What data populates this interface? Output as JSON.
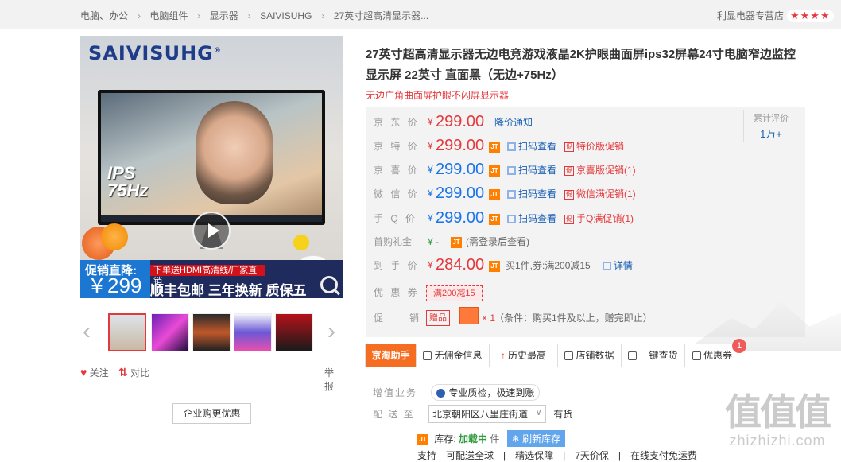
{
  "breadcrumb": [
    "电脑、办公",
    "电脑组件",
    "显示器",
    "SAIVISUHG",
    "27英寸超高清显示器..."
  ],
  "store": {
    "name": "利显电器专营店",
    "stars": "★★★★"
  },
  "gallery": {
    "brand_text": "SAIVISUHG",
    "brand_mark": "®",
    "ips_line1": "IPS",
    "ips_line2": "75Hz",
    "promo_label": "促销直降:",
    "promo_price": "￥299",
    "promo_red": "下单送HDMI高清线/厂家直销",
    "promo_white": "顺丰包邮 三年换新 质保五",
    "prev_arrow": "‹",
    "next_arrow": "›"
  },
  "actions": {
    "follow": "关注",
    "compare": "对比",
    "report": "举报",
    "corp_button": "企业购更优惠"
  },
  "product": {
    "title": "27英寸超高清显示器无边电竞游戏液晶2K护眼曲面屏ips32屏幕24寸电脑窄边监控显示屏 22英寸 直面黑（无边+75Hz）",
    "subtitle": "无边广角曲面屏护眼不闪屏显示器"
  },
  "prices": {
    "jd_label": "京 东 价",
    "jd_price": "299.00",
    "jd_notify": "降价通知",
    "special_label": "京 特 价",
    "special_price": "299.00",
    "special_promo": "特价版促销",
    "xi_label": "京 喜 价",
    "xi_price": "299.00",
    "xi_promo": "京喜版促销(1)",
    "wx_label": "微 信 价",
    "wx_price": "299.00",
    "wx_promo": "微信满促销(1)",
    "q_label": "手 Q 价",
    "q_price": "299.00",
    "q_promo": "手Q满促销(1)",
    "scan": "扫码查看",
    "yen": "¥",
    "first_label": "首购礼金",
    "first_value": "¥ -",
    "first_note": "(需登录后查看)",
    "hand_label": "到 手 价",
    "hand_price": "284.00",
    "hand_note": "买1件,券:满200减15",
    "hand_detail": "详情",
    "coupon_label": "优 惠 券",
    "coupon_value": "满200减15",
    "promo_label": "促　　销",
    "gift_tag": "赠品",
    "gift_qty": "× 1",
    "gift_note": "（条件：购买1件及以上，赠完即止）",
    "jt_icon": "JT"
  },
  "rating": {
    "label": "累计评价",
    "value": "1万+"
  },
  "tools": {
    "t1": "京淘助手",
    "t2": "无佣金信息",
    "t3": "历史最高",
    "t4": "店铺数据",
    "t5": "一键查货",
    "t6": "优惠券",
    "badge": "1"
  },
  "service": {
    "label": "增值业务",
    "pill": "专业质检，极速到账"
  },
  "shipping": {
    "label": "配 送 至",
    "address": "北京朝阳区八里庄街道",
    "chevron": "∨",
    "stock": "有货"
  },
  "stock": {
    "label": "库存:",
    "status": "加载中",
    "unit": "件",
    "refresh": "刷新库存"
  },
  "cut_row": "支持　可配送全球　|　精选保障　|　7天价保　|　在线支付免运费",
  "watermark": {
    "big": "值值值",
    "small": "zhizhizhi.com"
  }
}
